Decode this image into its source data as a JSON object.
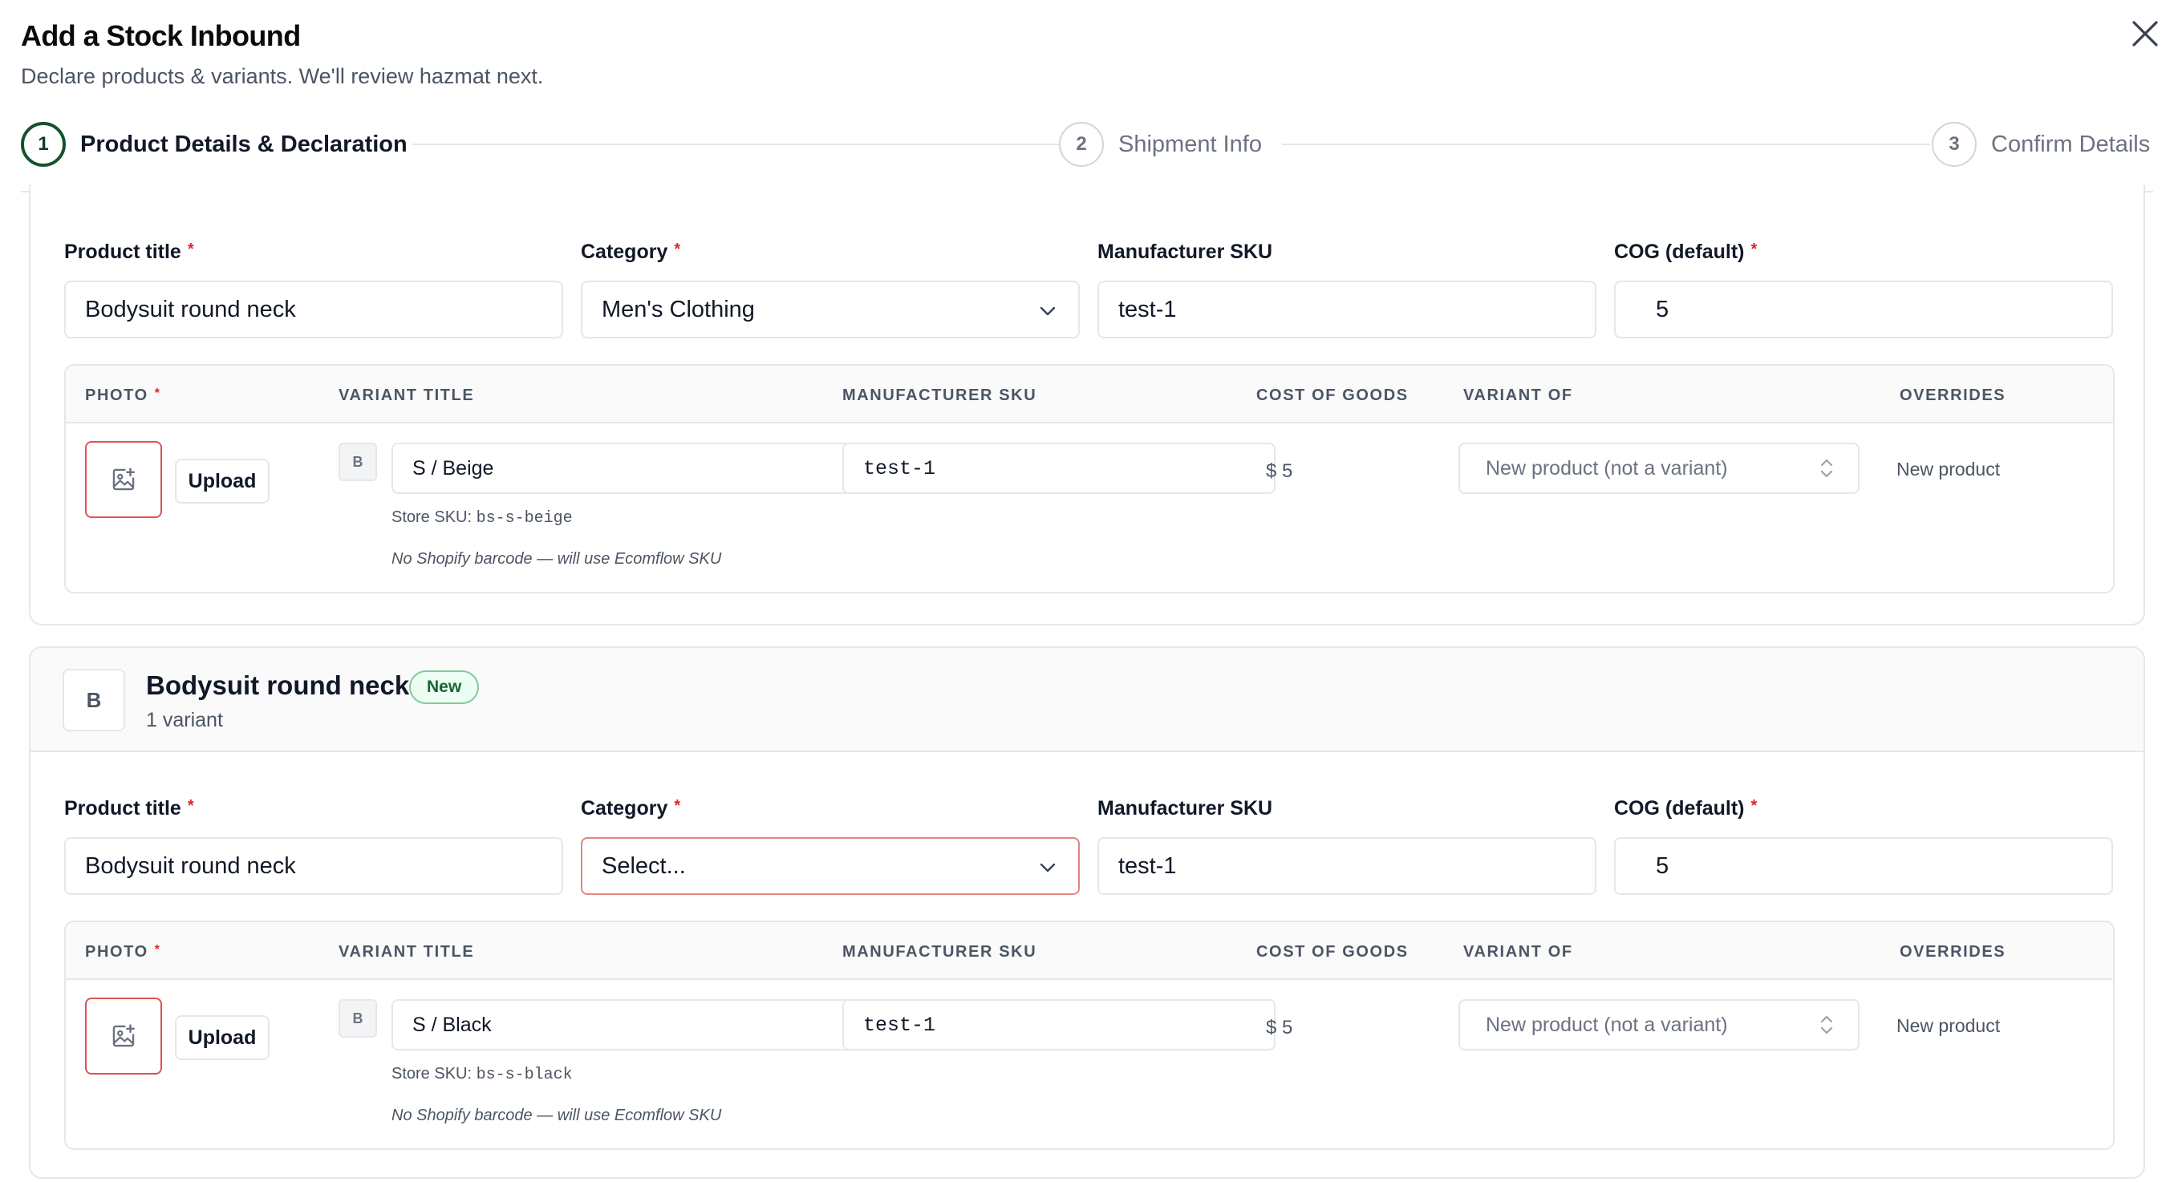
{
  "dialog": {
    "title": "Add a Stock Inbound",
    "subtitle": "Declare products & variants. We'll review hazmat next."
  },
  "stepper": {
    "steps": [
      {
        "number": "1",
        "label": "Product Details & Declaration",
        "state": "active"
      },
      {
        "number": "2",
        "label": "Shipment Info",
        "state": "upcoming"
      },
      {
        "number": "3",
        "label": "Confirm Details",
        "state": "upcoming"
      }
    ]
  },
  "labels": {
    "product_title": "Product title",
    "category": "Category",
    "manufacturer_sku": "Manufacturer SKU",
    "cog_default": "COG (default)",
    "required_mark": "*",
    "upload": "Upload",
    "store_sku_prefix": "Store SKU:",
    "barcode_note": "No Shopify barcode — will use Ecomflow SKU"
  },
  "table_headers": {
    "photo": "PHOTO",
    "variant_title": "VARIANT TITLE",
    "manufacturer_sku": "MANUFACTURER SKU",
    "cost_of_goods": "COST OF GOODS",
    "variant_of": "VARIANT OF",
    "overrides": "OVERRIDES"
  },
  "products": [
    {
      "product_title": "Bodysuit round neck",
      "category": "Men's Clothing",
      "manufacturer_sku": "test-1",
      "cog": "5",
      "variant": {
        "thumb": "B",
        "title": "S / Beige",
        "manufacturer_sku": "test-1",
        "store_sku": "bs-s-beige",
        "cost": "$ 5",
        "variant_of": "New product (not a variant)",
        "override": "New product"
      }
    },
    {
      "header": {
        "avatar": "B",
        "title": "Bodysuit round neck",
        "badge": "New",
        "variant_count": "1 variant"
      },
      "product_title": "Bodysuit round neck",
      "category": "Select...",
      "manufacturer_sku": "test-1",
      "cog": "5",
      "variant": {
        "thumb": "B",
        "title": "S / Black",
        "manufacturer_sku": "test-1",
        "store_sku": "bs-s-black",
        "cost": "$ 5",
        "variant_of": "New product (not a variant)",
        "override": "New product"
      }
    }
  ],
  "colors": {
    "accent": "#14532d",
    "error_border": "#e05252",
    "required": "#dc2626",
    "badge_bg": "#ecfdf3",
    "badge_text": "#166534"
  },
  "icons": {
    "close": "close-icon",
    "photo_add": "image-plus-icon",
    "chevron": "chevron-down-icon",
    "select_arrows": "chevron-up-down-icon"
  }
}
